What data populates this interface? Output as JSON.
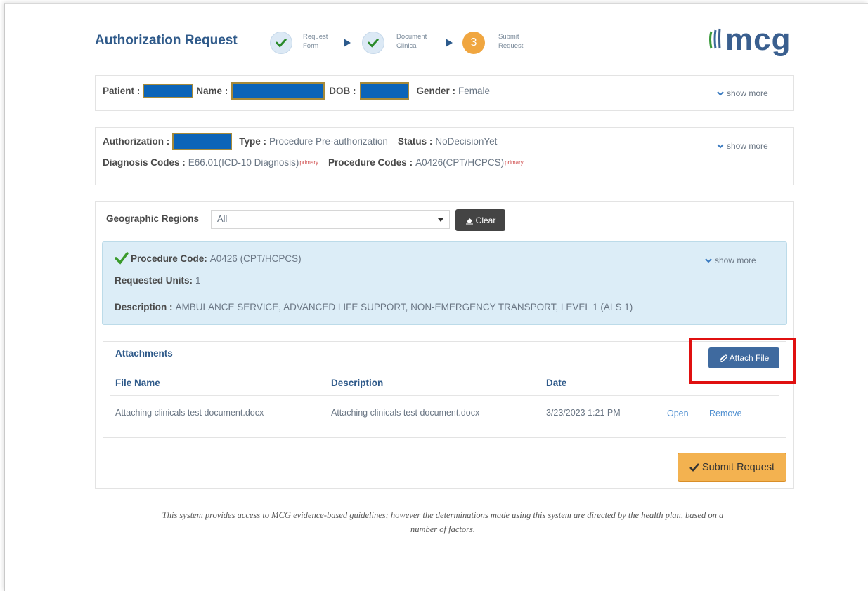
{
  "header": {
    "title": "Authorization Request",
    "steps": [
      {
        "line1": "Request",
        "line2": "Form",
        "state": "done"
      },
      {
        "line1": "Document",
        "line2": "Clinical",
        "state": "done"
      },
      {
        "number": "3",
        "line1": "Submit",
        "line2": "Request",
        "state": "current"
      }
    ],
    "logo_text": "mcg"
  },
  "patient": {
    "patient_label": "Patient :",
    "name_label": "Name :",
    "dob_label": "DOB :",
    "gender_label": "Gender :",
    "gender_value": "Female",
    "show_more": "show more"
  },
  "authorization": {
    "auth_label": "Authorization :",
    "type_label": "Type :",
    "type_value": "Procedure Pre-authorization",
    "status_label": "Status :",
    "status_value": "NoDecisionYet",
    "diag_label": "Diagnosis Codes :",
    "diag_value": "E66.01(ICD-10 Diagnosis)",
    "diag_tag": "primary",
    "proc_label": "Procedure Codes :",
    "proc_value": "A0426(CPT/HCPCS)",
    "proc_tag": "primary",
    "show_more": "show more"
  },
  "filters": {
    "geo_label": "Geographic Regions",
    "geo_value": "All",
    "clear_label": "Clear"
  },
  "procedure": {
    "code_label": "Procedure Code:",
    "code_value": "A0426 (CPT/HCPCS)",
    "units_label": "Requested Units:",
    "units_value": "1",
    "desc_label": "Description :",
    "desc_value": "AMBULANCE SERVICE, ADVANCED LIFE SUPPORT, NON-EMERGENCY TRANSPORT, LEVEL 1 (ALS 1)",
    "show_more": "show more"
  },
  "attachments": {
    "title": "Attachments",
    "attach_button": "Attach File",
    "columns": [
      "File Name",
      "Description",
      "Date"
    ],
    "rows": [
      {
        "file_name": "Attaching clinicals test document.docx",
        "description": "Attaching clinicals test document.docx",
        "date": "3/23/2023 1:21 PM",
        "open": "Open",
        "remove": "Remove"
      }
    ]
  },
  "submit_label": "Submit Request",
  "disclaimer": {
    "line1": "This system provides access to MCG evidence-based guidelines; however the determinations made using this system are directed by the health plan, based on a",
    "line2": "number of factors."
  },
  "colors": {
    "brand_blue": "#2f5a8a",
    "step_current": "#f0a640",
    "check_green": "#3a9a2c",
    "info_panel": "#dcedf7",
    "highlight_red": "#e01010",
    "submit_orange": "#f3b250"
  }
}
